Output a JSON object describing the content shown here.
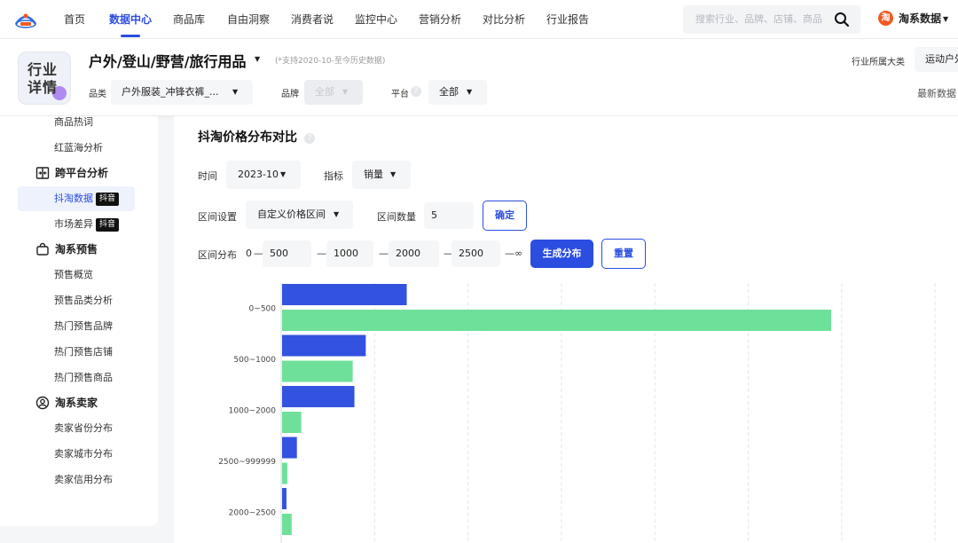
{
  "nav": {
    "items": [
      {
        "label": "首页"
      },
      {
        "label": "数据中心",
        "active": true
      },
      {
        "label": "商品库"
      },
      {
        "label": "自由洞察"
      },
      {
        "label": "消费者说"
      },
      {
        "label": "监控中心"
      },
      {
        "label": "营销分析"
      },
      {
        "label": "对比分析"
      },
      {
        "label": "行业报告"
      }
    ],
    "search_placeholder": "搜索行业、品牌、店铺、商品",
    "user": {
      "badge": "淘",
      "name": "淘系数据"
    },
    "logo_icon": "brand-logo-icon"
  },
  "header": {
    "badge_text": "行业详情",
    "title": "户外/登山/野营/旅行用品",
    "note": "(*支持2020-10-至今历史数据)",
    "category_label": "品类",
    "category_value": "户外服装_冲锋衣裤_...",
    "brand_label": "品牌",
    "brand_value": "全部",
    "platform_label": "平台",
    "platform_value": "全部",
    "industry_label": "行业所属大类",
    "industry_value": "运动户外",
    "latest_data": "最新数据",
    "help_icon": "question-icon"
  },
  "sidebar": {
    "items_top": [
      {
        "label": "商品热词"
      },
      {
        "label": "红蓝海分析"
      }
    ],
    "groups": [
      {
        "label": "跨平台分析",
        "icon": "compare-icon",
        "items": [
          {
            "label": "抖淘数据",
            "tag": "抖音",
            "active": true
          },
          {
            "label": "市场差异",
            "tag": "抖音"
          }
        ]
      },
      {
        "label": "淘系预售",
        "icon": "bag-icon",
        "items": [
          {
            "label": "预售概览"
          },
          {
            "label": "预售品类分析"
          },
          {
            "label": "热门预售品牌"
          },
          {
            "label": "热门预售店铺"
          },
          {
            "label": "热门预售商品"
          }
        ]
      },
      {
        "label": "淘系卖家",
        "icon": "user-icon",
        "items": [
          {
            "label": "卖家省份分布"
          },
          {
            "label": "卖家城市分布"
          },
          {
            "label": "卖家信用分布"
          }
        ]
      }
    ]
  },
  "main": {
    "title": "抖淘价格分布对比",
    "time_label": "时间",
    "time_value": "2023-10",
    "metric_label": "指标",
    "metric_value": "销量",
    "range_setting_label": "区间设置",
    "range_setting_value": "自定义价格区间",
    "range_count_label": "区间数量",
    "range_count_value": "5",
    "confirm_label": "确定",
    "distribution_label": "区间分布",
    "start_value": "0",
    "breakpoints": [
      "500",
      "1000",
      "2000",
      "2500"
    ],
    "end_symbol": "∞",
    "generate_label": "生成分布",
    "reset_label": "重置"
  },
  "chart_data": {
    "type": "bar",
    "orientation": "horizontal",
    "categories": [
      "0~500",
      "500~1000",
      "1000~2000",
      "2500~999999",
      "2000~2500"
    ],
    "series": [
      {
        "color": "#3352e0",
        "values": [
          143,
          96,
          83,
          17,
          5
        ]
      },
      {
        "color": "#6fe09a",
        "values": [
          630,
          81,
          22,
          6,
          11
        ]
      }
    ],
    "xlim": [
      0,
      750
    ],
    "grid": "vertical dashed",
    "legend": "none"
  }
}
